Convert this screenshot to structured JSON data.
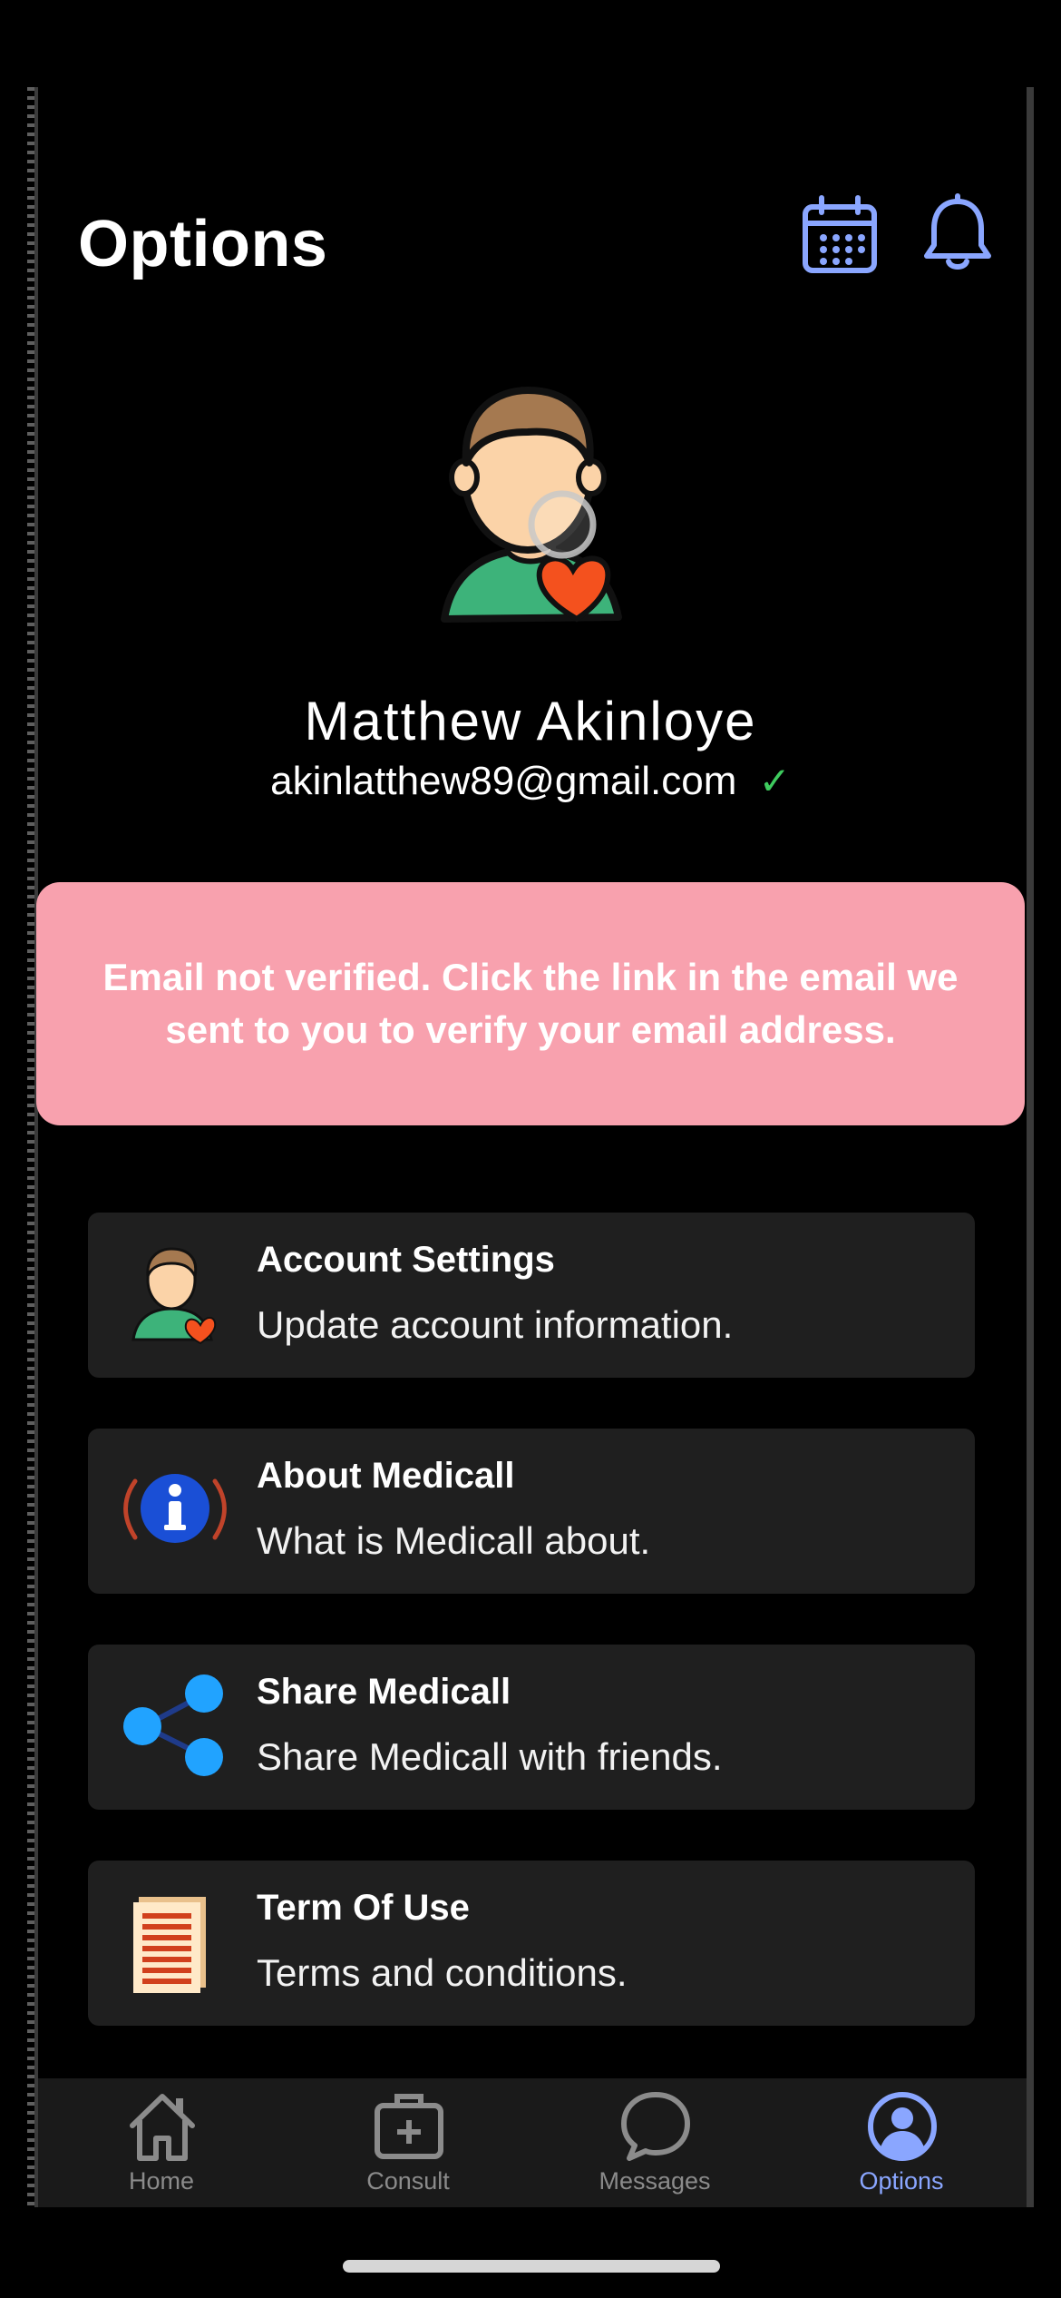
{
  "header": {
    "title": "Options",
    "calendar_icon": "calendar-icon",
    "bell_icon": "bell-icon"
  },
  "profile": {
    "avatar_icon": "user-heart-avatar-icon",
    "name": "Matthew Akinloye",
    "email": "akinlatthew89@gmail.com",
    "verified_mark": "✓"
  },
  "banner": {
    "message": "Email not verified. Click the link in the email we sent to you to verify your email address."
  },
  "menu": {
    "items": [
      {
        "title": "Account Settings",
        "subtitle": "Update account information.",
        "icon": "user-heart-icon"
      },
      {
        "title": "About Medicall",
        "subtitle": "What is Medicall about.",
        "icon": "info-icon"
      },
      {
        "title": "Share Medicall",
        "subtitle": "Share Medicall with friends.",
        "icon": "share-icon"
      },
      {
        "title": "Term Of Use",
        "subtitle": "Terms and conditions.",
        "icon": "document-icon"
      }
    ]
  },
  "tabbar": {
    "tabs": [
      {
        "label": "Home",
        "icon": "home-icon"
      },
      {
        "label": "Consult",
        "icon": "medical-kit-icon"
      },
      {
        "label": "Messages",
        "icon": "chat-bubble-icon"
      },
      {
        "label": "Options",
        "icon": "user-circle-icon"
      }
    ],
    "active": "Options"
  },
  "colors": {
    "accent": "#8aa6ff",
    "banner_bg": "#f8a1ae",
    "card_bg": "#1f1f1f",
    "verified": "#3ecb5e"
  }
}
